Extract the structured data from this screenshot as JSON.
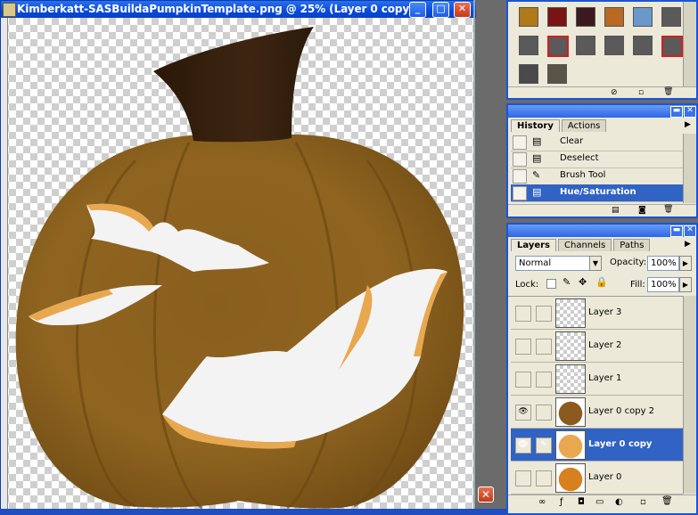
{
  "document": {
    "title": "Kimberkatt-SASBuildaPumpkinTemplate.png @ 25% (Layer 0 copy,...",
    "controls": {
      "minimize": "_",
      "maximize": "□",
      "close": "✕"
    }
  },
  "swatches": {
    "colors": [
      "#b07a18",
      "#7a1414",
      "#3a1a20",
      "#b86a20",
      "#6a98c8",
      "#5a5a5a",
      "#5a5a5a",
      "#5a5a5a",
      "#5a5a5a",
      "#5a5a5a",
      "#5a5a5a",
      "#5a5a5a",
      "#4a4a4a",
      "#5a5448"
    ]
  },
  "history": {
    "tabs": [
      "History",
      "Actions"
    ],
    "items": [
      {
        "label": "Clear",
        "icon": "document-icon"
      },
      {
        "label": "Deselect",
        "icon": "document-icon"
      },
      {
        "label": "Brush Tool",
        "icon": "brush-icon"
      },
      {
        "label": "Hue/Saturation",
        "icon": "document-icon",
        "selected": true
      }
    ]
  },
  "layers": {
    "tabs": [
      "Layers",
      "Channels",
      "Paths"
    ],
    "blend_mode": "Normal",
    "opacity_label": "Opacity:",
    "opacity_value": "100%",
    "lock_label": "Lock:",
    "fill_label": "Fill:",
    "fill_value": "100%",
    "items": [
      {
        "name": "Layer 3",
        "visible": false
      },
      {
        "name": "Layer 2",
        "visible": false
      },
      {
        "name": "Layer 1",
        "visible": false
      },
      {
        "name": "Layer 0 copy 2",
        "visible": true
      },
      {
        "name": "Layer 0 copy",
        "visible": true,
        "selected": true
      },
      {
        "name": "Layer 0",
        "visible": false
      }
    ]
  }
}
